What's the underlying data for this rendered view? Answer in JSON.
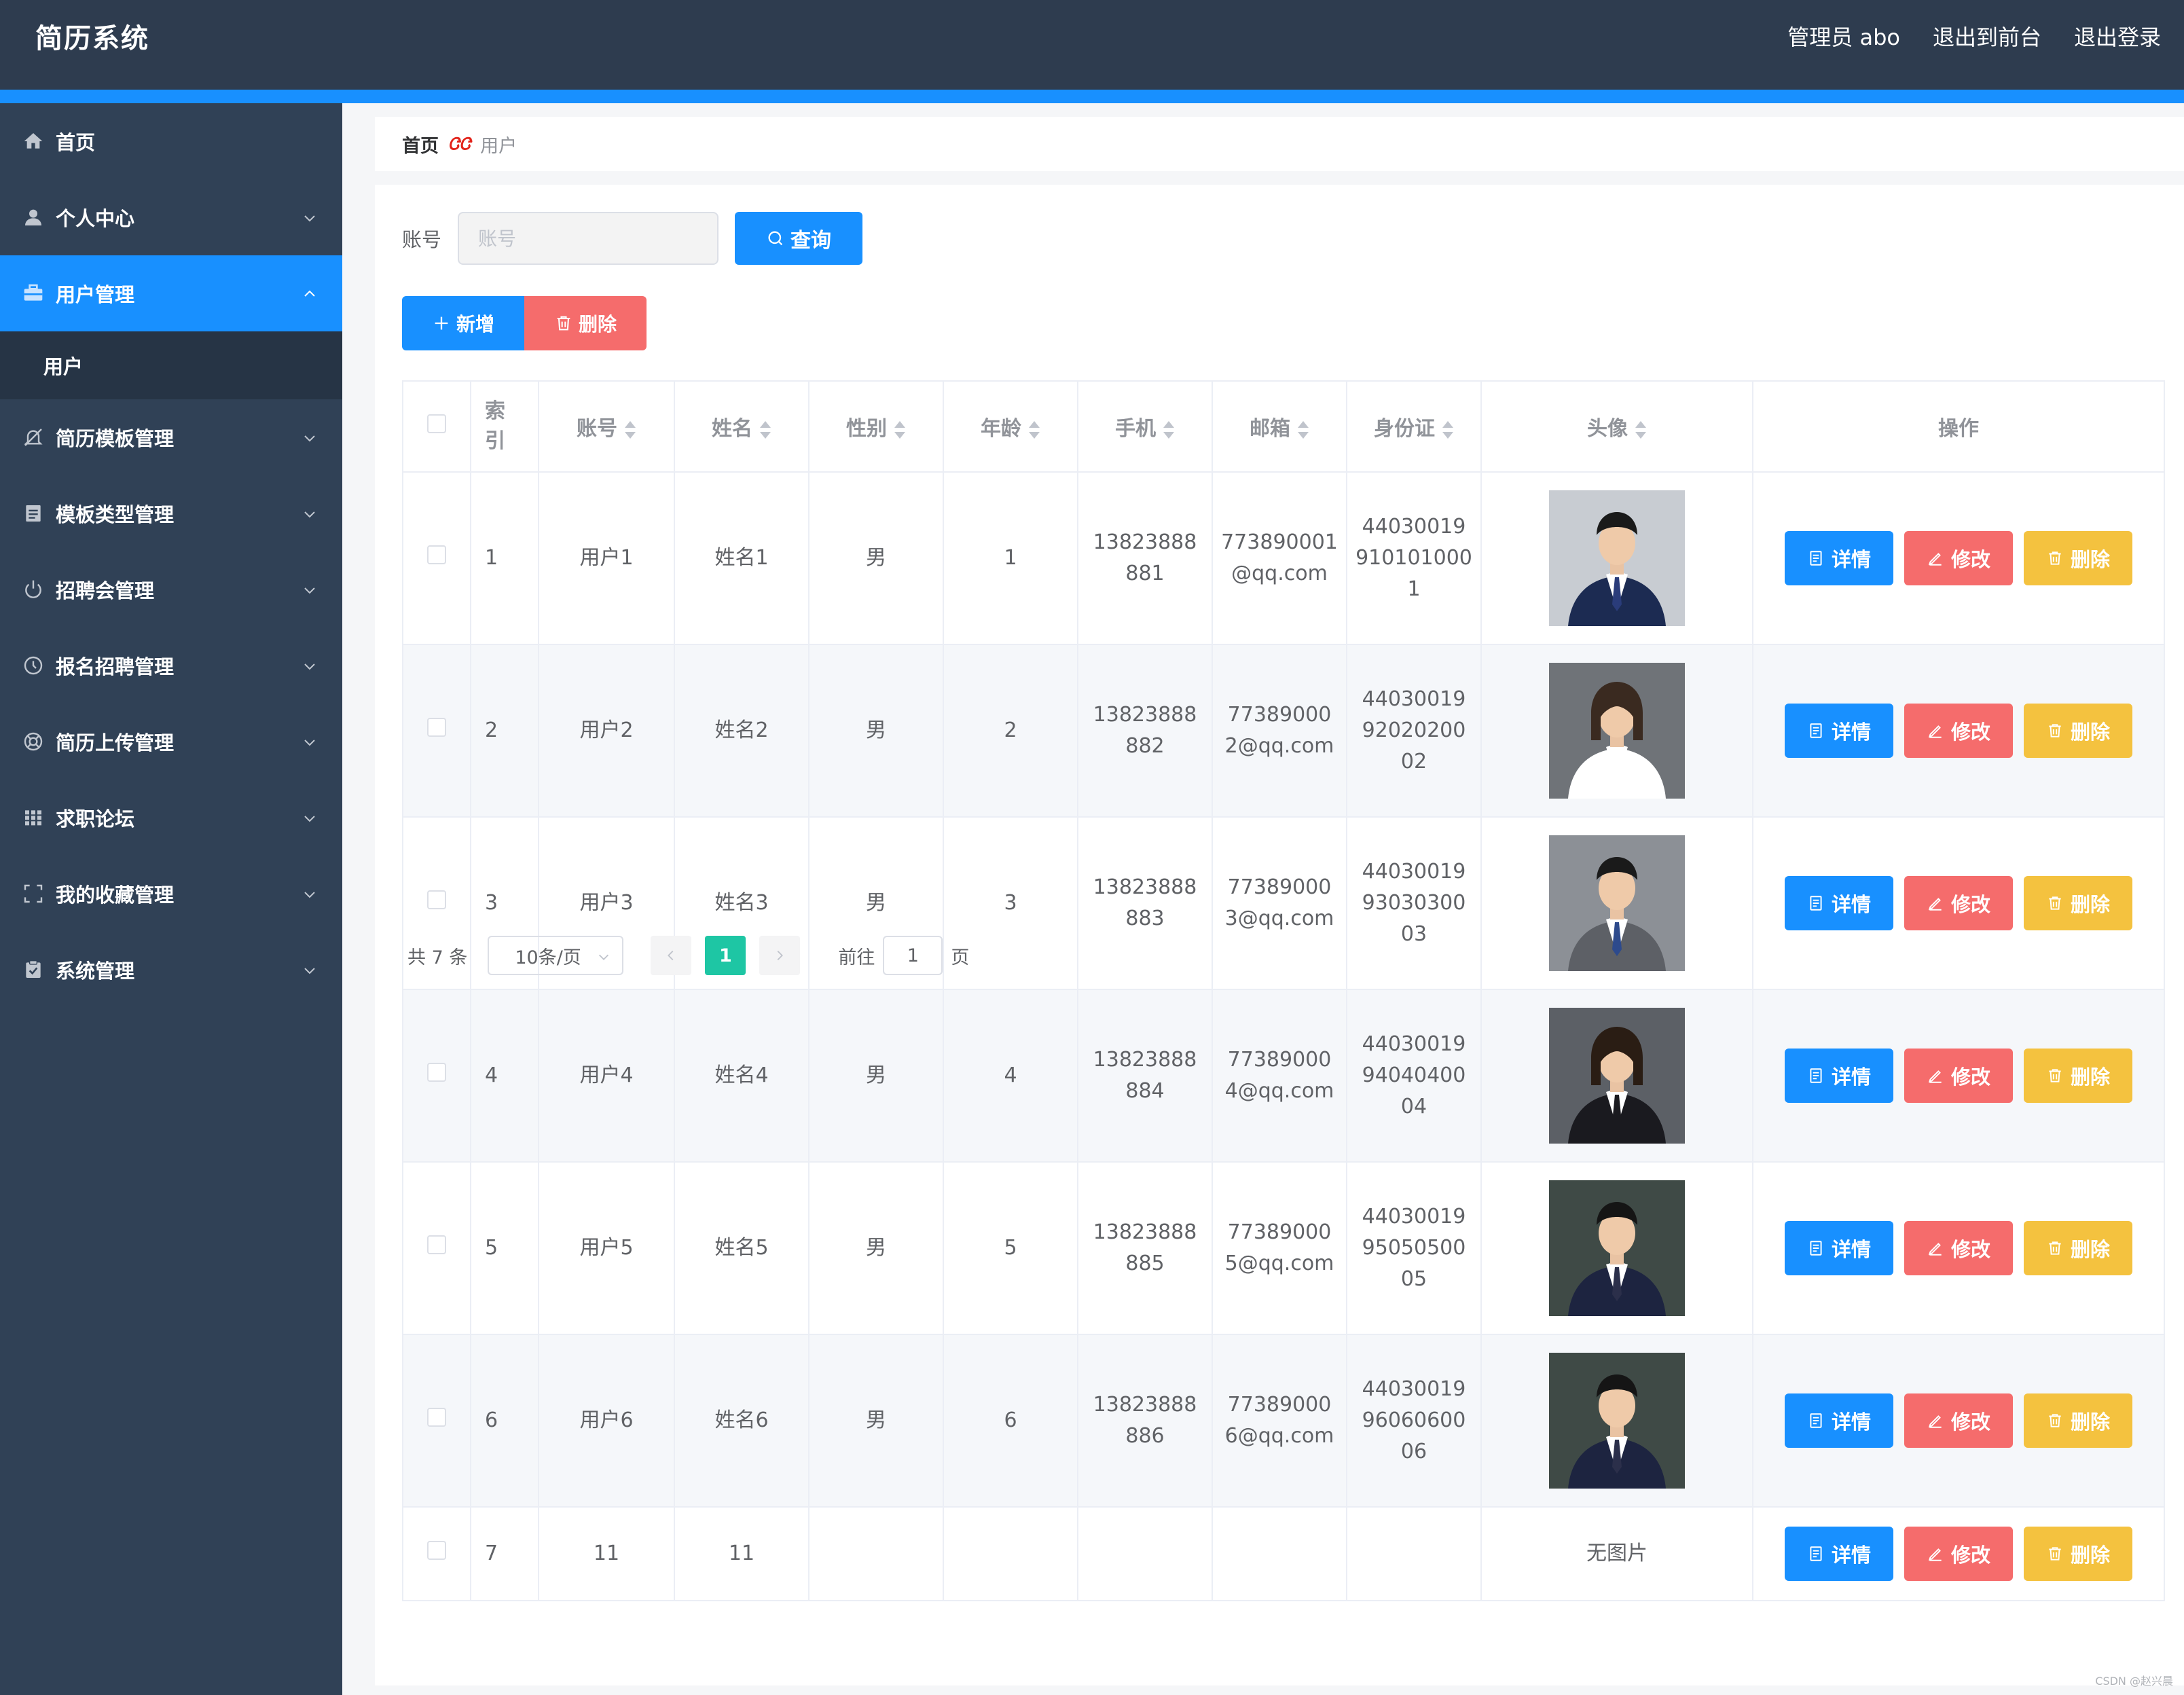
{
  "app": {
    "title": "简历系统"
  },
  "header": {
    "user": "管理员 abo",
    "to_front": "退出到前台",
    "logout": "退出登录"
  },
  "sidebar": {
    "items": [
      {
        "label": "首页",
        "icon": "home-icon",
        "expandable": false
      },
      {
        "label": "个人中心",
        "icon": "user-icon",
        "expandable": true
      },
      {
        "label": "用户管理",
        "icon": "briefcase-icon",
        "expandable": true,
        "active": true
      },
      {
        "label": "用户",
        "sub": true
      },
      {
        "label": "简历模板管理",
        "icon": "bell-off-icon",
        "expandable": true
      },
      {
        "label": "模板类型管理",
        "icon": "document-icon",
        "expandable": true
      },
      {
        "label": "招聘会管理",
        "icon": "power-icon",
        "expandable": true
      },
      {
        "label": "报名招聘管理",
        "icon": "clock-icon",
        "expandable": true
      },
      {
        "label": "简历上传管理",
        "icon": "lifebuoy-icon",
        "expandable": true
      },
      {
        "label": "求职论坛",
        "icon": "grid-icon",
        "expandable": true
      },
      {
        "label": "我的收藏管理",
        "icon": "fullscreen-icon",
        "expandable": true
      },
      {
        "label": "系统管理",
        "icon": "clipboard-check-icon",
        "expandable": true
      }
    ]
  },
  "breadcrumb": {
    "home": "首页",
    "separator": "ᏣᏣ",
    "current": "用户"
  },
  "search": {
    "label": "账号",
    "placeholder": "账号",
    "value": "",
    "button": "查询"
  },
  "actions": {
    "add": "新增",
    "delete": "删除"
  },
  "table": {
    "headers": {
      "index": "索引",
      "account": "账号",
      "name": "姓名",
      "gender": "性别",
      "age": "年龄",
      "phone": "手机",
      "email": "邮箱",
      "idcard": "身份证",
      "avatar": "头像",
      "ops": "操作"
    },
    "op_labels": {
      "detail": "详情",
      "edit": "修改",
      "delete": "删除"
    },
    "rows": [
      {
        "index": "1",
        "account": "用户1",
        "name": "姓名1",
        "gender": "男",
        "age": "1",
        "phone": [
          "13823888",
          "881"
        ],
        "email": [
          "773890001",
          "@qq.com"
        ],
        "idcard": [
          "44030019",
          "910101000",
          "1"
        ],
        "avatar": "photo-male"
      },
      {
        "index": "2",
        "account": "用户2",
        "name": "姓名2",
        "gender": "男",
        "age": "2",
        "phone": [
          "13823888",
          "882"
        ],
        "email": [
          "77389000",
          "2@qq.com"
        ],
        "idcard": [
          "44030019",
          "92020200",
          "02"
        ],
        "avatar": "photo-female"
      },
      {
        "index": "3",
        "account": "用户3",
        "name": "姓名3",
        "gender": "男",
        "age": "3",
        "phone": [
          "13823888",
          "883"
        ],
        "email": [
          "77389000",
          "3@qq.com"
        ],
        "idcard": [
          "44030019",
          "93030300",
          "03"
        ],
        "avatar": "photo-male-grey"
      },
      {
        "index": "4",
        "account": "用户4",
        "name": "姓名4",
        "gender": "男",
        "age": "4",
        "phone": [
          "13823888",
          "884"
        ],
        "email": [
          "77389000",
          "4@qq.com"
        ],
        "idcard": [
          "44030019",
          "94040400",
          "04"
        ],
        "avatar": "photo-female-dark"
      },
      {
        "index": "5",
        "account": "用户5",
        "name": "姓名5",
        "gender": "男",
        "age": "5",
        "phone": [
          "13823888",
          "885"
        ],
        "email": [
          "77389000",
          "5@qq.com"
        ],
        "idcard": [
          "44030019",
          "95050500",
          "05"
        ],
        "avatar": "photo-male-dark"
      },
      {
        "index": "6",
        "account": "用户6",
        "name": "姓名6",
        "gender": "男",
        "age": "6",
        "phone": [
          "13823888",
          "886"
        ],
        "email": [
          "77389000",
          "6@qq.com"
        ],
        "idcard": [
          "44030019",
          "96060600",
          "06"
        ],
        "avatar": "photo-male-dark"
      },
      {
        "index": "7",
        "account": "11",
        "name": "11",
        "gender": "",
        "age": "",
        "phone": [],
        "email": [],
        "idcard": [],
        "avatar": "",
        "no_image": "无图片"
      }
    ]
  },
  "pagination": {
    "total": "共 7 条",
    "page_size": "10条/页",
    "current": "1",
    "goto_label": "前往",
    "goto_value": "1",
    "page_suffix": "页"
  },
  "watermark": "CSDN @赵兴晨",
  "colors": {
    "header_bg": "#2e3c4f",
    "sidebar_bg": "#304156",
    "primary": "#1890ff",
    "danger": "#f56c6c",
    "warning": "#f4c23f",
    "success": "#1ec6a4"
  }
}
